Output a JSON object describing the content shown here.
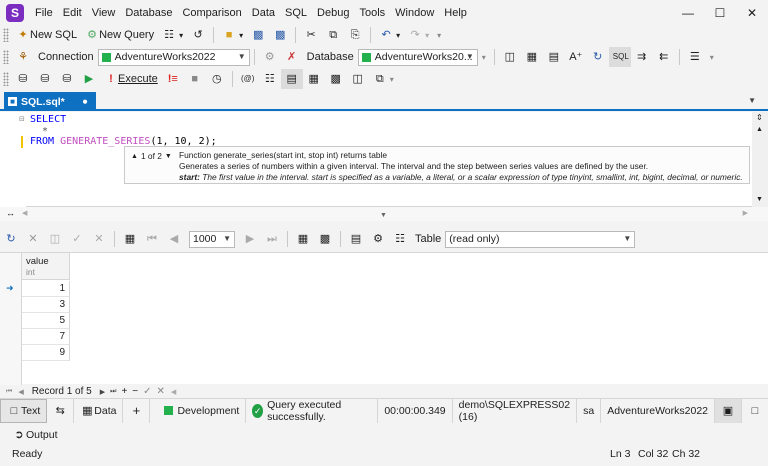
{
  "menu": [
    "File",
    "Edit",
    "View",
    "Database",
    "Comparison",
    "Data",
    "SQL",
    "Debug",
    "Tools",
    "Window",
    "Help"
  ],
  "toolbar1": {
    "new_sql": "New SQL",
    "new_query": "New Query"
  },
  "toolbar2": {
    "connection_label": "Connection",
    "connection_value": "AdventureWorks2022",
    "database_label": "Database",
    "database_value": "AdventureWorks20..."
  },
  "toolbar3": {
    "execute": "Execute"
  },
  "doc_tab": {
    "label": "SQL.sql*"
  },
  "editor": {
    "line1": "SELECT",
    "line2": "*",
    "line3_kw": "FROM",
    "line3_fn": "GENERATE_SERIES",
    "line3_args": "(1, 10, 2);"
  },
  "hint": {
    "counter": "1 of 2",
    "signature": "Function generate_series(start int, stop int) returns table",
    "description": "Generates a series of numbers within a given interval. The interval and the step between series values are defined by the user.",
    "param_name": "start:",
    "param_desc": "The first value in the interval. start is specified as a variable, a literal, or a scalar expression of type tinyint, smallint, int, bigint, decimal, or numeric."
  },
  "result_toolbar": {
    "page_size": "1000",
    "table_label": "Table",
    "table_mode": "(read only)"
  },
  "grid": {
    "column": {
      "name": "value",
      "type": "int"
    },
    "rows": [
      "1",
      "3",
      "5",
      "7",
      "9"
    ]
  },
  "navbar": {
    "record": "Record 1 of 5"
  },
  "status1": {
    "text_tab": "Text",
    "data_tab": "Data",
    "environment": "Development",
    "message": "Query executed successfully.",
    "elapsed": "00:00:00.349",
    "server": "demo\\SQLEXPRESS02 (16)",
    "user": "sa",
    "database": "AdventureWorks2022"
  },
  "output": {
    "label": "Output"
  },
  "statusbar": {
    "ready": "Ready",
    "ln": "Ln 3",
    "col": "Col 32",
    "ch": "Ch 32"
  },
  "colors": {
    "accent": "#0e70c0",
    "green": "#22b14c",
    "logo": "#7a2dbf"
  }
}
